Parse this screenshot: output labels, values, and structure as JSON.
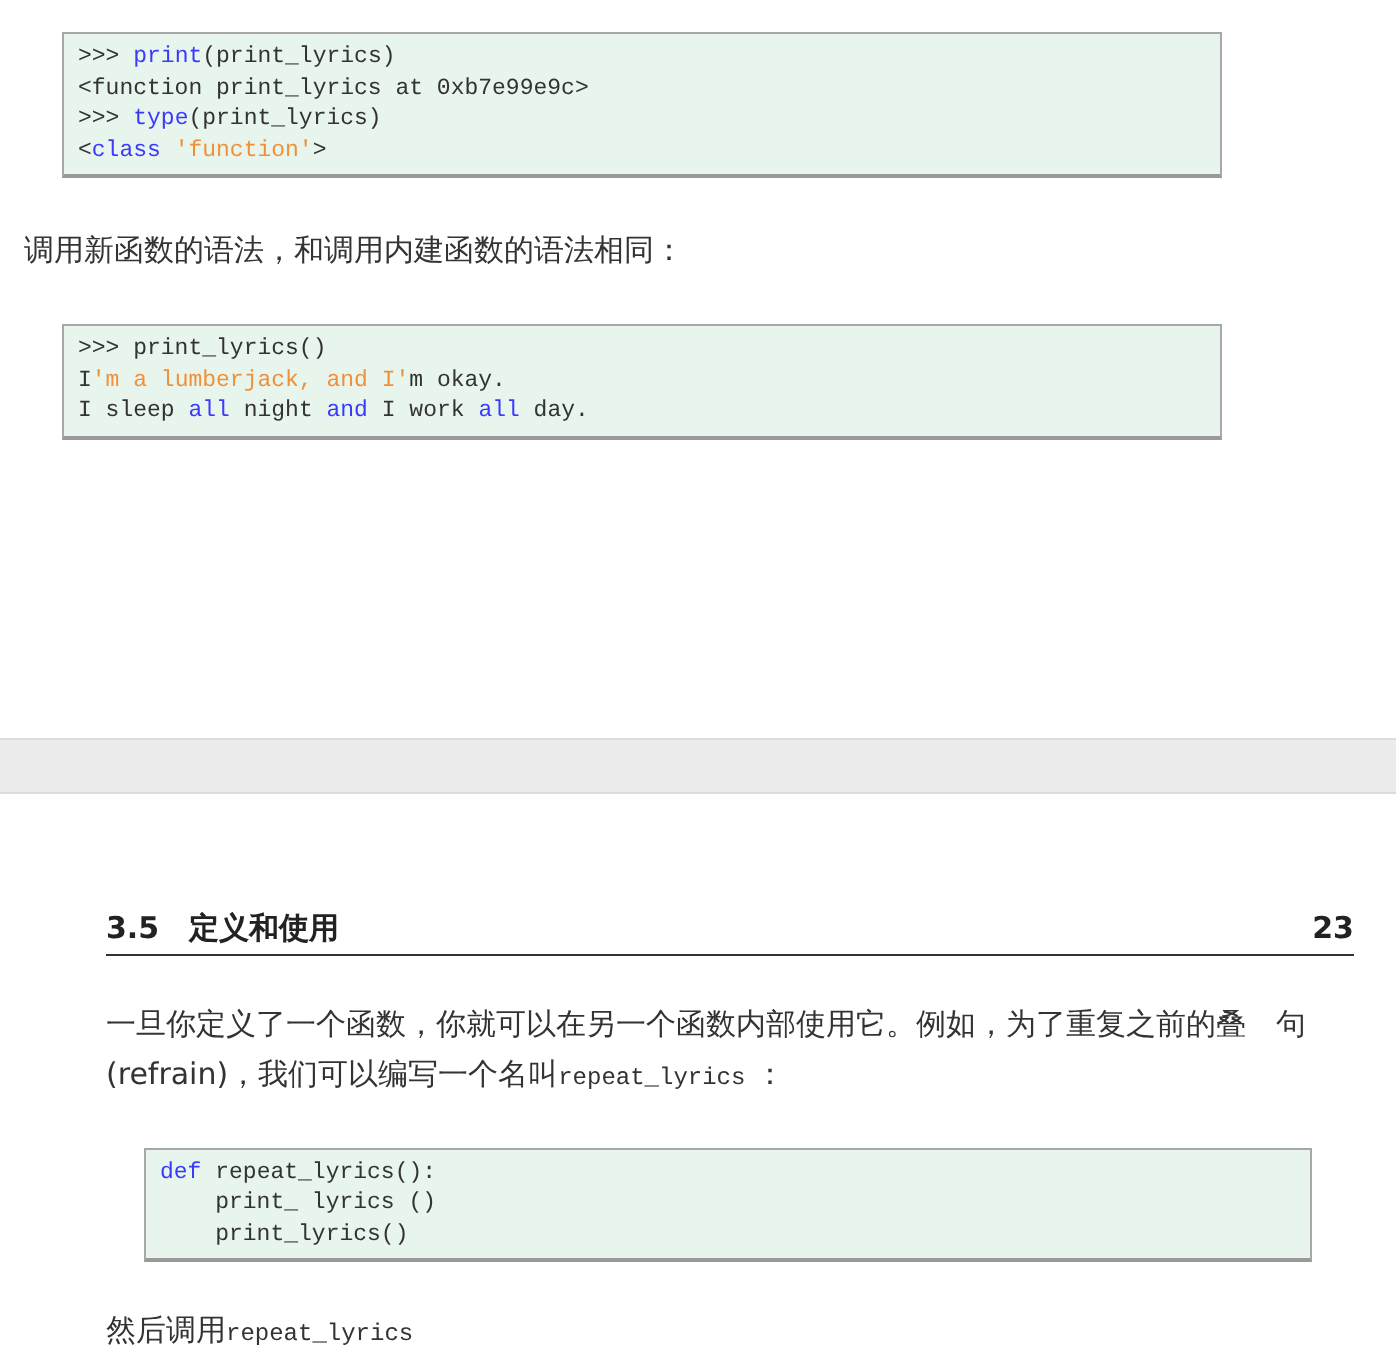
{
  "pages": [
    {
      "blocks": [
        {
          "kind": "code",
          "lines": [
            [
              {
                "text": ">>> ",
                "kind": "plain"
              },
              {
                "text": "print",
                "kind": "keyword"
              },
              {
                "text": "(print_lyrics)",
                "kind": "plain"
              }
            ],
            [
              {
                "text": "<function print_lyrics at 0xb7e99e9c>",
                "kind": "plain"
              }
            ],
            [
              {
                "text": ">>> ",
                "kind": "plain"
              },
              {
                "text": "type",
                "kind": "keyword"
              },
              {
                "text": "(print_lyrics)",
                "kind": "plain"
              }
            ],
            [
              {
                "text": "<",
                "kind": "plain"
              },
              {
                "text": "class",
                "kind": "keyword"
              },
              {
                "text": " 'function'",
                "kind": "string"
              },
              {
                "text": ">",
                "kind": "plain"
              }
            ]
          ]
        },
        {
          "kind": "paragraph",
          "segments": [
            {
              "text": "调用新函数的语法，和调用内建函数的语法相同：",
              "kind": "text"
            }
          ]
        },
        {
          "kind": "code",
          "lines": [
            [
              {
                "text": ">>> print_lyrics()",
                "kind": "plain"
              }
            ],
            [
              {
                "text": "I",
                "kind": "plain"
              },
              {
                "text": "'m a lumberjack, and I'",
                "kind": "string"
              },
              {
                "text": "m okay.",
                "kind": "plain"
              }
            ],
            [
              {
                "text": "I sleep ",
                "kind": "plain"
              },
              {
                "text": "all",
                "kind": "keyword"
              },
              {
                "text": " night ",
                "kind": "plain"
              },
              {
                "text": "and",
                "kind": "keyword"
              },
              {
                "text": " I work ",
                "kind": "plain"
              },
              {
                "text": "all",
                "kind": "keyword"
              },
              {
                "text": " day.",
                "kind": "plain"
              }
            ]
          ]
        }
      ]
    },
    {
      "header": {
        "section": "3.5",
        "title": "定义和使用",
        "page_number": "23"
      },
      "blocks": [
        {
          "kind": "paragraph",
          "segments": [
            {
              "text": "一旦你定义了一个函数，你就可以在另一个函数内部使用它。例如，为了重复之前的叠　句 (refrain)，我们可以编写一个名叫",
              "kind": "text"
            },
            {
              "text": "repeat_lyrics",
              "kind": "code"
            },
            {
              "text": " ：",
              "kind": "text"
            }
          ]
        },
        {
          "kind": "code",
          "lines": [
            [
              {
                "text": "def",
                "kind": "keyword"
              },
              {
                "text": " repeat_lyrics():",
                "kind": "plain"
              }
            ],
            [
              {
                "text": "    print_ lyrics ()",
                "kind": "plain"
              }
            ],
            [
              {
                "text": "    print_lyrics()",
                "kind": "plain"
              }
            ]
          ]
        },
        {
          "kind": "paragraph",
          "segments": [
            {
              "text": "然后调用",
              "kind": "text"
            },
            {
              "text": "repeat_lyrics",
              "kind": "code"
            }
          ]
        }
      ]
    }
  ]
}
